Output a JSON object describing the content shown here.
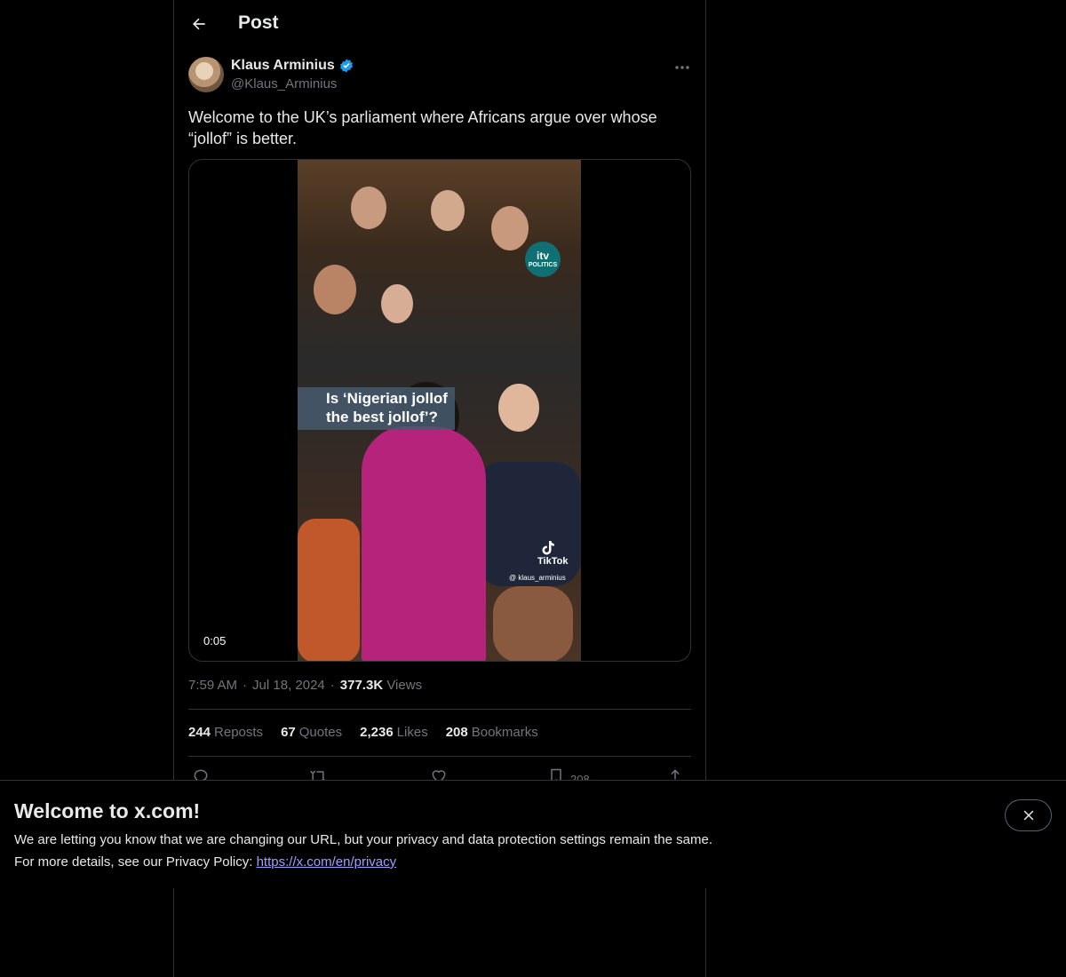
{
  "header": {
    "title": "Post"
  },
  "post": {
    "author": {
      "display_name": "Klaus Arminius",
      "handle": "@Klaus_Arminius",
      "verified": true
    },
    "text_line1": "Welcome to the UK’s parliament where Africans argue over whose",
    "text_line2": "“jollof” is better.",
    "media": {
      "caption_line1": "Is ‘Nigerian jollof",
      "caption_line2": "the best jollof’?",
      "itv_logo": "itv",
      "itv_sub": "POLITICS",
      "tiktok_label": "TikTok",
      "tiktok_user": "@ klaus_arminius",
      "duration": "0:05"
    },
    "time": "7:59 AM",
    "date": "Jul 18, 2024",
    "views_count": "377.3K",
    "views_label": "Views",
    "stats": [
      {
        "count": "244",
        "label": "Reposts"
      },
      {
        "count": "67",
        "label": "Quotes"
      },
      {
        "count": "2,236",
        "label": "Likes"
      },
      {
        "count": "208",
        "label": "Bookmarks"
      }
    ],
    "actions": {
      "bookmark_count": "208"
    }
  },
  "banner": {
    "title": "Welcome to x.com!",
    "line1": "We are letting you know that we are changing our URL, but your privacy and data protection settings remain the same.",
    "line2_prefix": "For more details, see our Privacy Policy: ",
    "link_text": "https://x.com/en/privacy"
  },
  "colors": {
    "verified": "#1d9bf0",
    "link": "#a69cff",
    "border": "#2f3336",
    "muted": "#71767b"
  }
}
